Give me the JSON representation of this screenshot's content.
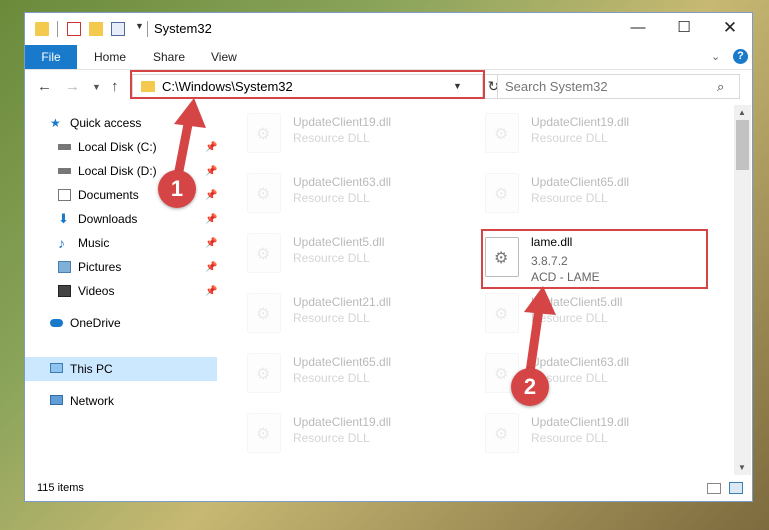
{
  "window": {
    "title": "System32",
    "controls": {
      "minimize": "—",
      "maximize": "☐",
      "close": "✕"
    }
  },
  "ribbon": {
    "tabs": [
      "File",
      "Home",
      "Share",
      "View"
    ],
    "help": "?"
  },
  "address": {
    "path": "C:\\Windows\\System32",
    "search_placeholder": "Search System32"
  },
  "sidebar": {
    "items": [
      {
        "label": "Quick access",
        "icon": "star-icon",
        "pinned": false
      },
      {
        "label": "Local Disk (C:)",
        "icon": "drive-icon",
        "pinned": true
      },
      {
        "label": "Local Disk (D:)",
        "icon": "drive-icon",
        "pinned": true
      },
      {
        "label": "Documents",
        "icon": "documents-icon",
        "pinned": true
      },
      {
        "label": "Downloads",
        "icon": "download-icon",
        "pinned": true
      },
      {
        "label": "Music",
        "icon": "music-icon",
        "pinned": true
      },
      {
        "label": "Pictures",
        "icon": "pictures-icon",
        "pinned": true
      },
      {
        "label": "Videos",
        "icon": "videos-icon",
        "pinned": true
      },
      {
        "label": "OneDrive",
        "icon": "cloud-icon",
        "pinned": false
      },
      {
        "label": "This PC",
        "icon": "computer-icon",
        "pinned": false,
        "selected": true
      },
      {
        "label": "Network",
        "icon": "network-icon",
        "pinned": false
      }
    ]
  },
  "files": {
    "left": [
      {
        "name": "UpdateClient19.dll",
        "type": "Resource DLL"
      },
      {
        "name": "UpdateClient63.dll",
        "type": "Resource DLL"
      },
      {
        "name": "UpdateClient5.dll",
        "type": "Resource DLL"
      },
      {
        "name": "UpdateClient21.dll",
        "type": "Resource DLL"
      },
      {
        "name": "UpdateClient65.dll",
        "type": "Resource DLL"
      },
      {
        "name": "UpdateClient19.dll",
        "type": "Resource DLL"
      }
    ],
    "right": [
      {
        "name": "UpdateClient19.dll",
        "type": "Resource DLL"
      },
      {
        "name": "UpdateClient65.dll",
        "type": "Resource DLL"
      },
      {
        "name": "UpdateClient5.dll",
        "type": "Resource DLL"
      },
      {
        "name": "UpdateClient63.dll",
        "type": "Resource DLL"
      },
      {
        "name": "UpdateClient19.dll",
        "type": "Resource DLL"
      }
    ],
    "highlighted": {
      "name": "lame.dll",
      "version": "3.8.7.2",
      "description": "ACD - LAME"
    }
  },
  "status": {
    "count": "115 items"
  },
  "annotations": {
    "marker1": "1",
    "marker2": "2",
    "color": "#d64545"
  }
}
